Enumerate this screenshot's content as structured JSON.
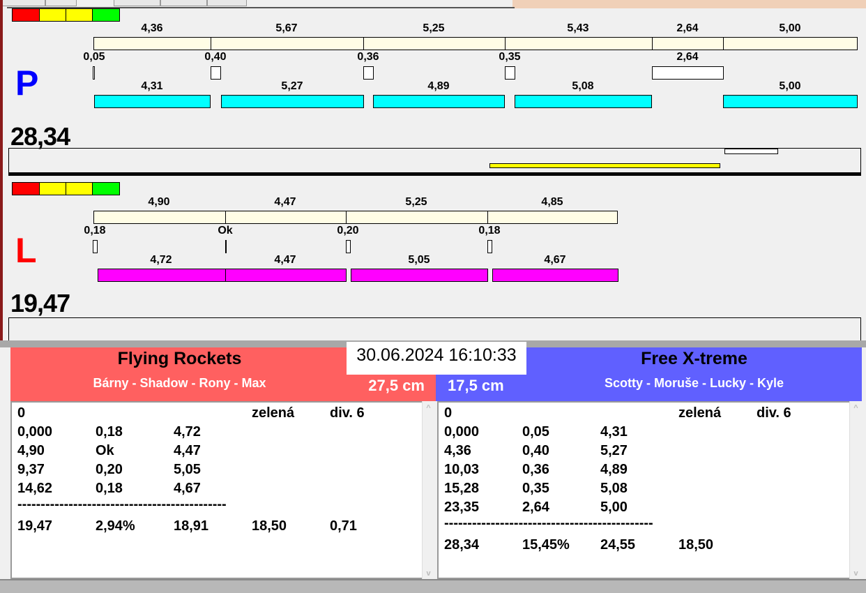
{
  "status_colors": [
    "#ff0000",
    "#ffff00",
    "#ffff00",
    "#00ff00"
  ],
  "P": {
    "letter": "P",
    "letter_color": "#0000ff",
    "total": "28,34",
    "top_labels": [
      "4,36",
      "5,67",
      "5,25",
      "5,43",
      "2,64",
      "5,00"
    ],
    "gap_labels": [
      "0,05",
      "0,40",
      "0,36",
      "0,35",
      "2,64"
    ],
    "bottom_labels": [
      "4,31",
      "5,27",
      "4,89",
      "5,08",
      "5,00"
    ]
  },
  "L": {
    "letter": "L",
    "letter_color": "#ff0000",
    "total": "19,47",
    "top_labels": [
      "4,90",
      "4,47",
      "5,25",
      "4,85"
    ],
    "gap_labels": [
      "0,18",
      "Ok",
      "0,20",
      "0,18"
    ],
    "bottom_labels": [
      "4,72",
      "4,47",
      "5,05",
      "4,67"
    ]
  },
  "datetime": "30.06.2024 16:10:33",
  "left_team": {
    "name": "Flying Rockets",
    "members": "Bárny - Shadow - Rony - Max",
    "height": "27,5 cm",
    "color": "#ff6060",
    "rows": [
      [
        "0",
        "",
        "",
        "zelená",
        "div. 6"
      ],
      [
        "0,000",
        "0,18",
        "4,72",
        "",
        ""
      ],
      [
        "4,90",
        "Ok",
        "4,47",
        "",
        ""
      ],
      [
        "9,37",
        "0,20",
        "5,05",
        "",
        ""
      ],
      [
        "14,62",
        "0,18",
        "4,67",
        "",
        ""
      ],
      [
        "---------------------------------------------",
        "",
        "",
        "",
        ""
      ],
      [
        "19,47",
        "2,94%",
        "18,91",
        "18,50",
        "0,71"
      ]
    ]
  },
  "right_team": {
    "name": "Free X-treme",
    "members": "Scotty - Moruše - Lucky - Kyle",
    "height": "17,5 cm",
    "color": "#6060ff",
    "rows": [
      [
        "0",
        "",
        "",
        "zelená",
        "div. 6"
      ],
      [
        "0,000",
        "0,05",
        "4,31",
        "",
        ""
      ],
      [
        "4,36",
        "0,40",
        "5,27",
        "",
        ""
      ],
      [
        "10,03",
        "0,36",
        "4,89",
        "",
        ""
      ],
      [
        "15,28",
        "0,35",
        "5,08",
        "",
        ""
      ],
      [
        "23,35",
        "2,64",
        "5,00",
        "",
        ""
      ],
      [
        "---------------------------------------------",
        "",
        "",
        "",
        ""
      ],
      [
        "28,34",
        "15,45%",
        "24,55",
        "18,50",
        ""
      ]
    ]
  }
}
